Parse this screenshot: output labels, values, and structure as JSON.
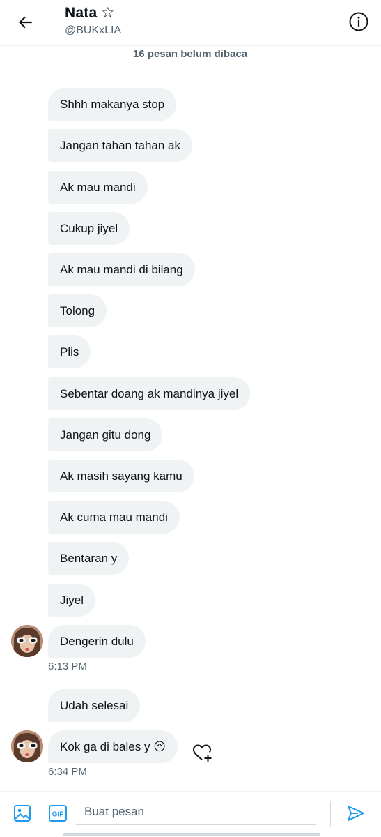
{
  "header": {
    "name": "Nata",
    "star": "☆",
    "handle": "@BUKxLIA"
  },
  "unread": "16 pesan belum dibaca",
  "messages": [
    "Shhh makanya stop",
    "Jangan tahan tahan ak",
    "Ak mau mandi",
    "Cukup jiyel",
    "Ak mau mandi di bilang",
    "Tolong",
    "Plis",
    "Sebentar doang ak mandinya jiyel",
    "Jangan gitu dong",
    "Ak masih sayang kamu",
    "Ak cuma mau mandi",
    "Bentaran y",
    "Jiyel",
    "Dengerin dulu",
    "Udah selesai",
    "Kok ga di bales y 😔"
  ],
  "times": [
    "6:13 PM",
    "6:34 PM"
  ],
  "composer": {
    "placeholder": "Buat pesan",
    "gif_label": "GIF"
  },
  "colors": {
    "accent": "#1d9bf0",
    "bubble": "#eff3f4",
    "muted": "#536471"
  }
}
